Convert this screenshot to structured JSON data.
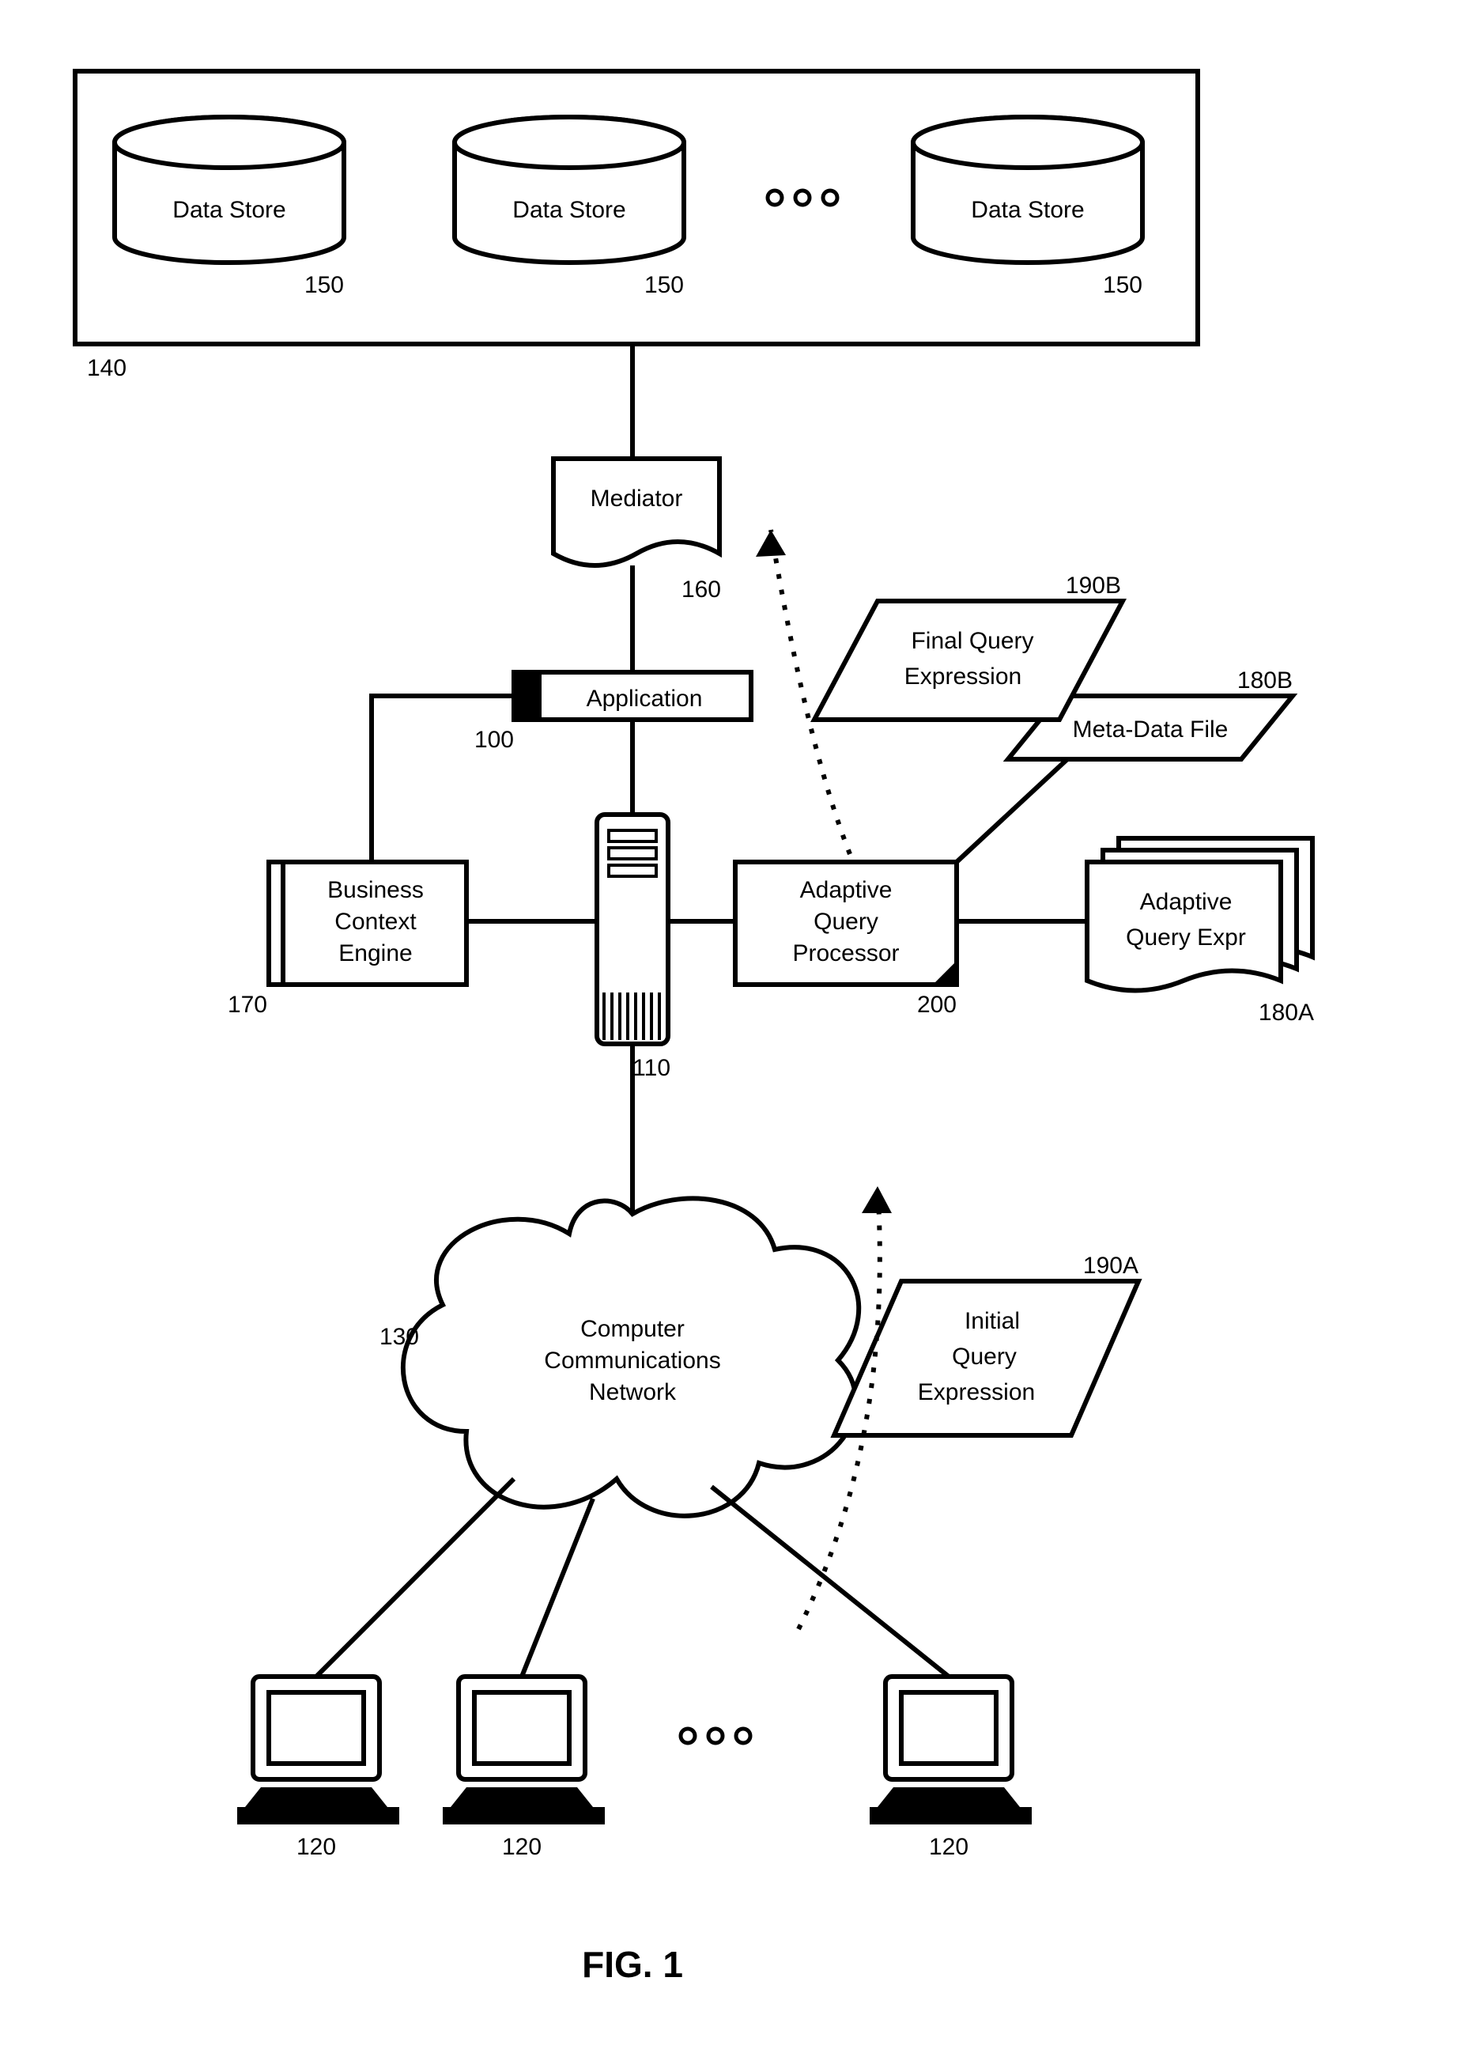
{
  "datastore_label": "Data Store",
  "datastore_ref": "150",
  "datastore_group_ref": "140",
  "ooo": "ooo",
  "mediator_label": "Mediator",
  "mediator_ref": "160",
  "application_label": "Application",
  "application_ref": "100",
  "bce_line1": "Business",
  "bce_line2": "Context",
  "bce_line3": "Engine",
  "bce_ref": "170",
  "server_ref": "110",
  "aqp_line1": "Adaptive",
  "aqp_line2": "Query",
  "aqp_line3": "Processor",
  "aqp_ref": "200",
  "metadata_label": "Meta-Data File",
  "metadata_ref": "180B",
  "aqe_line1": "Adaptive",
  "aqe_line2": "Query Expr",
  "aqe_ref": "180A",
  "finalq_line1": "Final Query",
  "finalq_line2": "Expression",
  "finalq_ref": "190B",
  "net_line1": "Computer",
  "net_line2": "Communications",
  "net_line3": "Network",
  "net_ref": "130",
  "initq_line1": "Initial",
  "initq_line2": "Query",
  "initq_line3": "Expression",
  "initq_ref": "190A",
  "client_ref": "120",
  "figure_caption": "FIG. 1"
}
